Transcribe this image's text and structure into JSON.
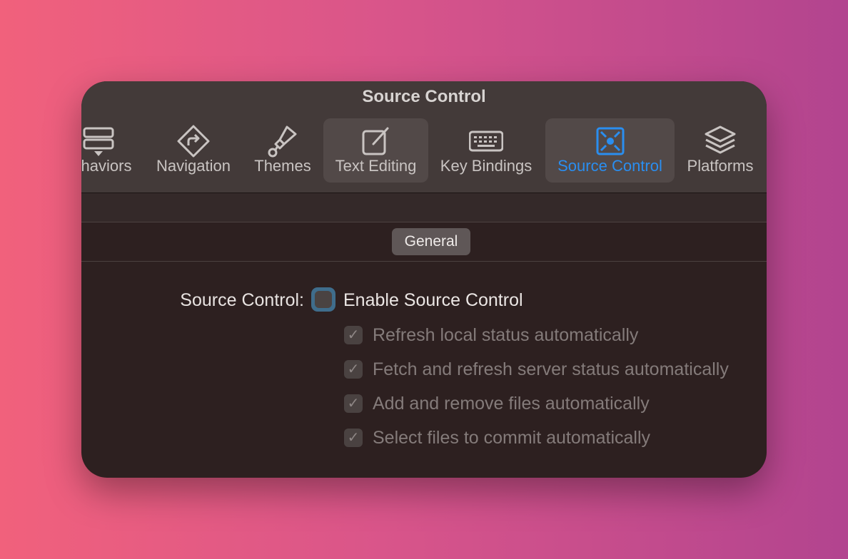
{
  "window": {
    "title": "Source Control"
  },
  "toolbar": {
    "items": [
      {
        "label": "haviors",
        "icon": "behaviors-icon"
      },
      {
        "label": "Navigation",
        "icon": "navigation-icon"
      },
      {
        "label": "Themes",
        "icon": "paintbrush-icon"
      },
      {
        "label": "Text Editing",
        "icon": "edit-icon"
      },
      {
        "label": "Key Bindings",
        "icon": "keyboard-icon"
      },
      {
        "label": "Source Control",
        "icon": "source-control-icon",
        "active": true
      },
      {
        "label": "Platforms",
        "icon": "layers-icon"
      }
    ]
  },
  "tabs": {
    "general": "General"
  },
  "settings": {
    "label": "Source Control:",
    "enable": "Enable Source Control",
    "enable_checked": false,
    "options": [
      {
        "label": "Refresh local status automatically",
        "checked": true
      },
      {
        "label": "Fetch and refresh server status automatically",
        "checked": true
      },
      {
        "label": "Add and remove files automatically",
        "checked": true
      },
      {
        "label": "Select files to commit automatically",
        "checked": true
      }
    ]
  },
  "colors": {
    "accent": "#2a8ef0",
    "focus_ring": "#3f6d8c"
  }
}
